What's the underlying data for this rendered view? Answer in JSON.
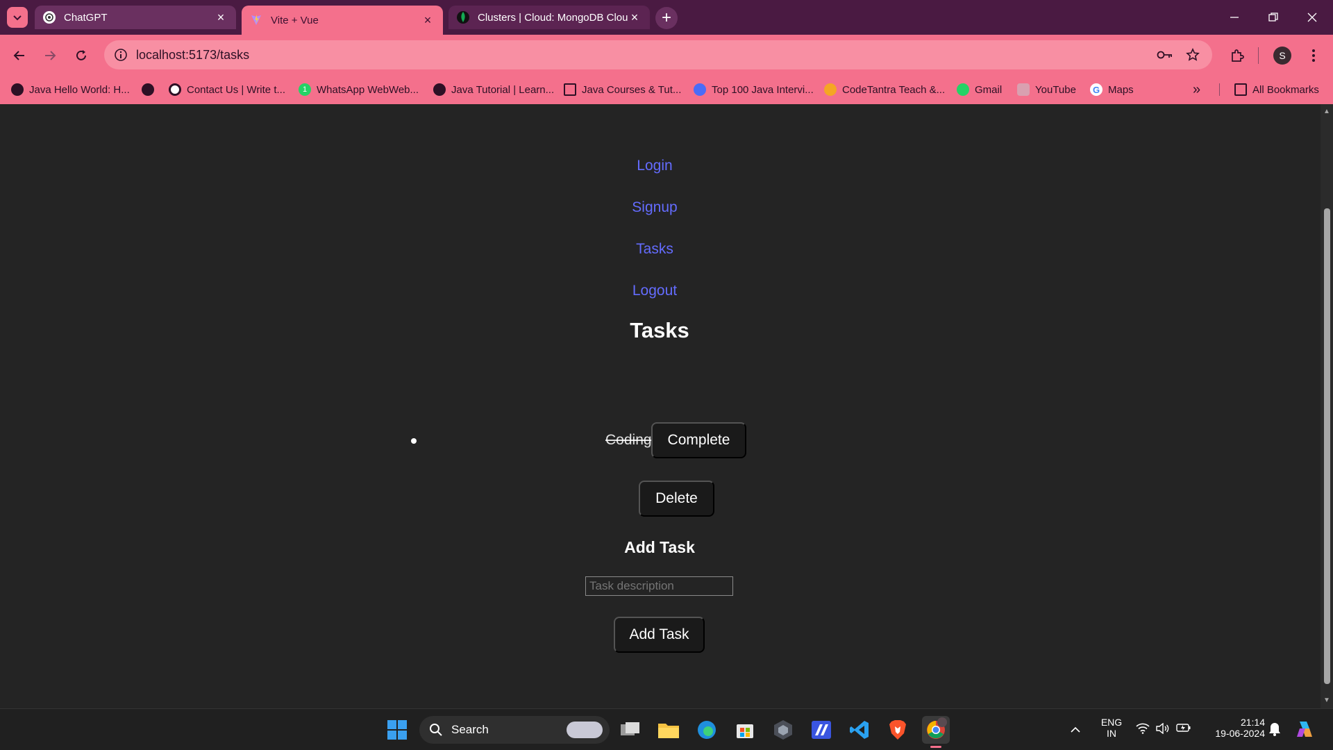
{
  "browser": {
    "tabs": [
      {
        "title": "ChatGPT"
      },
      {
        "title": "Vite + Vue"
      },
      {
        "title": "Clusters | Cloud: MongoDB Clou"
      }
    ],
    "address": "localhost:5173/tasks",
    "profile_initial": "S",
    "bookmarks": [
      {
        "label": "Java Hello World: H..."
      },
      {
        "label": ""
      },
      {
        "label": "Contact Us | Write t..."
      },
      {
        "label": "WhatsApp WebWeb..."
      },
      {
        "label": "Java Tutorial | Learn..."
      },
      {
        "label": "Java Courses & Tut..."
      },
      {
        "label": "Top 100 Java Intervi..."
      },
      {
        "label": "CodeTantra Teach &..."
      },
      {
        "label": "Gmail"
      },
      {
        "label": "YouTube"
      },
      {
        "label": "Maps"
      }
    ],
    "all_bookmarks": "All Bookmarks"
  },
  "page": {
    "nav": {
      "login": "Login",
      "signup": "Signup",
      "tasks": "Tasks",
      "logout": "Logout"
    },
    "title": "Tasks",
    "task": {
      "description": "Coding",
      "complete_label": "Complete",
      "delete_label": "Delete",
      "completed": true
    },
    "add_task": {
      "heading": "Add Task",
      "placeholder": "Task description",
      "value": "",
      "button_label": "Add Task"
    },
    "colors": {
      "link": "#646cff",
      "background": "#242424",
      "button": "#1a1a1a",
      "browser_accent": "#f4708c"
    }
  },
  "taskbar": {
    "search_label": "Search",
    "lang_top": "ENG",
    "lang_bottom": "IN",
    "time": "21:14",
    "date": "19-06-2024"
  }
}
